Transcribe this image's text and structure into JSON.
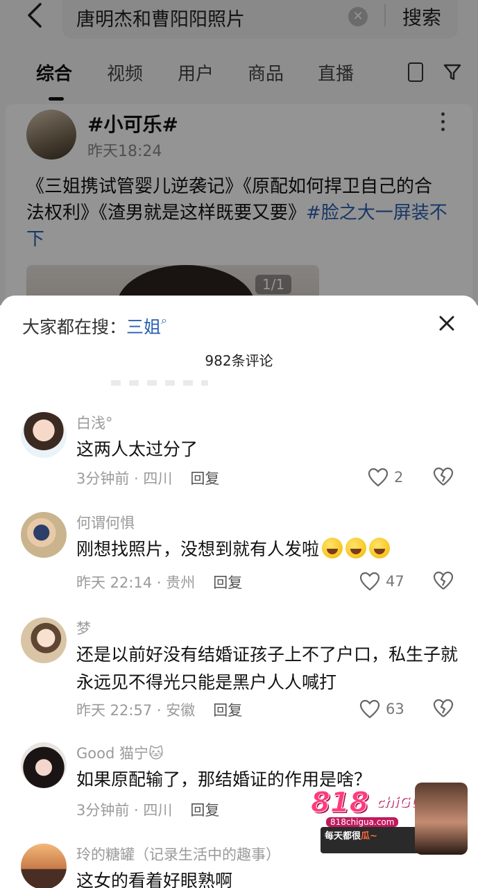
{
  "search": {
    "query": "唐明杰和曹阳阳照片",
    "submit_label": "搜索"
  },
  "tabs": [
    {
      "label": "综合",
      "active": true
    },
    {
      "label": "视频"
    },
    {
      "label": "用户"
    },
    {
      "label": "商品"
    },
    {
      "label": "直播"
    }
  ],
  "post": {
    "author": "#小可乐#",
    "time": "昨天18:24",
    "body_text": "《三姐携试管婴儿逆袭记》《原配如何捍卫自己的合法权利》《渣男就是这样既要又要》",
    "body_tag": "#脸之大一屏装不下",
    "image_count": "1/1"
  },
  "sheet": {
    "hot_search_label": "大家都在搜：",
    "hot_search_term": "三姐",
    "comment_count": "982条评论"
  },
  "comments": [
    {
      "name": "白浅°",
      "text": "这两人太过分了",
      "time": "3分钟前",
      "location": "四川",
      "reply": "回复",
      "likes": "2"
    },
    {
      "name": "何谓何惧",
      "text": "刚想找照片，没想到就有人发啦",
      "time": "昨天 22:14",
      "location": "贵州",
      "reply": "回复",
      "likes": "47"
    },
    {
      "name": "梦",
      "text": "还是以前好没有结婚证孩子上不了户口，私生子就永远见不得光只能是黑户人人喊打",
      "time": "昨天 22:57",
      "location": "安徽",
      "reply": "回复",
      "likes": "63"
    },
    {
      "name": "Good 猫宁🐱",
      "text": "如果原配输了，那结婚证的作用是啥？",
      "time": "3分钟前",
      "location": "四川",
      "reply": "回复",
      "likes": ""
    },
    {
      "name": "玲的糖罐（记录生活中的趣事）",
      "text": "这女的看着好眼熟啊",
      "time": "",
      "location": "",
      "reply": "",
      "likes": ""
    }
  ],
  "watermark": {
    "logo": "818",
    "logo_sub": "chiGUA",
    "url": "818chigua.com",
    "slogan_a": "每天都很",
    "slogan_b": "瓜~"
  },
  "colors": {
    "link_blue": "#2a5fb0",
    "meta_gray": "#9a9a9a",
    "watermark_pink": "#ff3b7a"
  }
}
